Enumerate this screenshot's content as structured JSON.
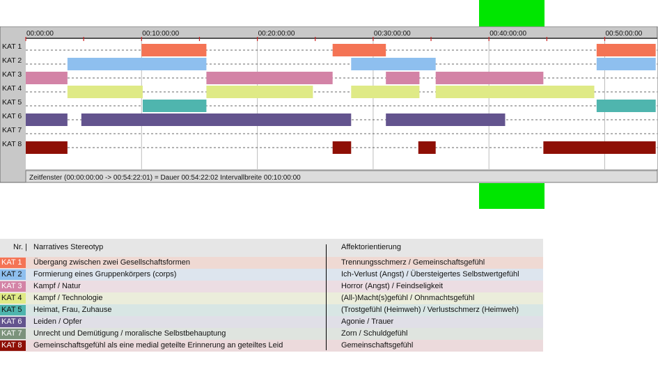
{
  "chart_data": {
    "type": "timeline",
    "x_unit": "hh:mm:ss",
    "x_range": [
      "00:00:00",
      "00:54:22"
    ],
    "tick_labels": [
      "00:00:00",
      "00:10:00:00",
      "00:20:00:00",
      "00:30:00:00",
      "00:40:00:00",
      "00:50:00:00"
    ],
    "ticks_minutes": [
      0,
      10,
      20,
      30,
      40,
      50
    ],
    "categories": [
      "KAT 1",
      "KAT 2",
      "KAT 3",
      "KAT 4",
      "KAT 5",
      "KAT 6",
      "KAT 7",
      "KAT 8"
    ],
    "colors": [
      "#f47455",
      "#8ebfef",
      "#d383a6",
      "#dfea86",
      "#4fb5ae",
      "#63548e",
      "#7b927b",
      "#8e0f05"
    ],
    "series": [
      {
        "category": "KAT 1",
        "segments": [
          [
            10.0,
            15.6
          ],
          [
            26.5,
            31.1
          ],
          [
            49.3,
            54.4
          ]
        ]
      },
      {
        "category": "KAT 2",
        "segments": [
          [
            3.6,
            15.6
          ],
          [
            28.1,
            35.4
          ],
          [
            49.3,
            54.4
          ]
        ]
      },
      {
        "category": "KAT 3",
        "segments": [
          [
            0,
            3.6
          ],
          [
            15.6,
            26.5
          ],
          [
            31.1,
            34.0
          ],
          [
            35.4,
            44.7
          ]
        ]
      },
      {
        "category": "KAT 4",
        "segments": [
          [
            3.6,
            10.1
          ],
          [
            15.6,
            24.8
          ],
          [
            28.1,
            34.0
          ],
          [
            35.4,
            49.1
          ]
        ]
      },
      {
        "category": "KAT 5",
        "segments": [
          [
            10.1,
            15.6
          ],
          [
            49.3,
            54.4
          ]
        ]
      },
      {
        "category": "KAT 6",
        "segments": [
          [
            0,
            3.6
          ],
          [
            4.8,
            28.1
          ],
          [
            31.1,
            41.4
          ]
        ]
      },
      {
        "category": "KAT 7",
        "segments": []
      },
      {
        "category": "KAT 8",
        "segments": [
          [
            0,
            3.6
          ],
          [
            26.5,
            28.1
          ],
          [
            33.9,
            35.4
          ],
          [
            44.7,
            54.4
          ]
        ]
      }
    ],
    "footer_text": "Zeitfenster (00:00:00:00 -> 00:54:22:01) = Dauer 00:54:22:02    Intervallbreite 00:10:00:00"
  },
  "legend": {
    "header": {
      "nr": "Nr. |",
      "stereotype": "Narratives Stereotyp",
      "affect": "Affektorientierung"
    },
    "rows": [
      {
        "kat": "KAT 1",
        "stereotype": "Übergang zwischen zwei Gesellschaftsformen",
        "affect": "Trennungsschmerz / Gemeinschaftsgefühl",
        "bg": "#efd9d3"
      },
      {
        "kat": "KAT 2",
        "stereotype": "Formierung eines Gruppenkörpers (corps)",
        "affect": "Ich-Verlust (Angst) / Übersteigertes Selbstwertgefühl",
        "bg": "#dde5ee"
      },
      {
        "kat": "KAT 3",
        "stereotype": "Kampf / Natur",
        "affect": "Horror (Angst) / Feindseligkeit",
        "bg": "#ecdde3"
      },
      {
        "kat": "KAT 4",
        "stereotype": "Kampf / Technologie",
        "affect": "(All-)Macht(s)gefühl / Ohnmachtsgefühl",
        "bg": "#ebeddb"
      },
      {
        "kat": "KAT 5",
        "stereotype": "Heimat, Frau, Zuhause",
        "affect": "(Trostgefühl (Heimweh) / Verlustschmerz (Heimweh)",
        "bg": "#d8e6e4"
      },
      {
        "kat": "KAT 6",
        "stereotype": "Leiden / Opfer",
        "affect": "Agonie / Trauer",
        "bg": "#e0dfe7"
      },
      {
        "kat": "KAT 7",
        "stereotype": "Unrecht und Demütigung / moralische Selbstbehauptung",
        "affect": "Zorn / Schuldgefühl",
        "bg": "#dfe4df"
      },
      {
        "kat": "KAT 8",
        "stereotype": "Gemeinschaftsgefühl als eine medial geteilte Erinnerung an geteiltes Leid",
        "affect": "Gemeinschaftsgefühl",
        "bg": "#ecdadc"
      }
    ]
  }
}
